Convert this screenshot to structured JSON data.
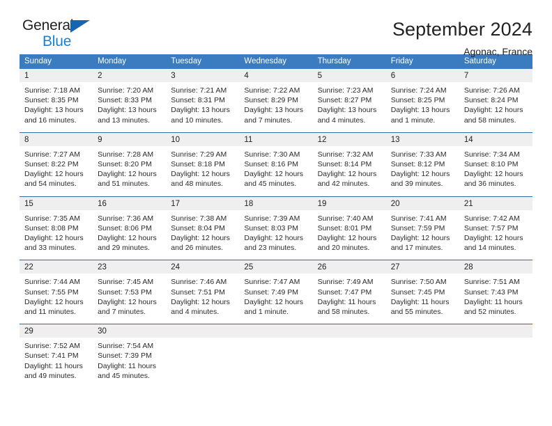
{
  "brand": {
    "name_top": "General",
    "name_bottom": "Blue",
    "triangle_color": "#1565b0",
    "text_color": "#231f20",
    "accent_color": "#1b7fd4"
  },
  "header": {
    "title": "September 2024",
    "subtitle": "Agonac, France"
  },
  "theme": {
    "header_bg": "#3b7cc0",
    "header_text": "#ffffff",
    "daynum_bg": "#efefef",
    "week_divider": "#2c68ac"
  },
  "calendar": {
    "weekday_headers": [
      "Sunday",
      "Monday",
      "Tuesday",
      "Wednesday",
      "Thursday",
      "Friday",
      "Saturday"
    ],
    "weeks": [
      [
        {
          "day": "1",
          "sunrise": "Sunrise: 7:18 AM",
          "sunset": "Sunset: 8:35 PM",
          "daylight_1": "Daylight: 13 hours",
          "daylight_2": "and 16 minutes."
        },
        {
          "day": "2",
          "sunrise": "Sunrise: 7:20 AM",
          "sunset": "Sunset: 8:33 PM",
          "daylight_1": "Daylight: 13 hours",
          "daylight_2": "and 13 minutes."
        },
        {
          "day": "3",
          "sunrise": "Sunrise: 7:21 AM",
          "sunset": "Sunset: 8:31 PM",
          "daylight_1": "Daylight: 13 hours",
          "daylight_2": "and 10 minutes."
        },
        {
          "day": "4",
          "sunrise": "Sunrise: 7:22 AM",
          "sunset": "Sunset: 8:29 PM",
          "daylight_1": "Daylight: 13 hours",
          "daylight_2": "and 7 minutes."
        },
        {
          "day": "5",
          "sunrise": "Sunrise: 7:23 AM",
          "sunset": "Sunset: 8:27 PM",
          "daylight_1": "Daylight: 13 hours",
          "daylight_2": "and 4 minutes."
        },
        {
          "day": "6",
          "sunrise": "Sunrise: 7:24 AM",
          "sunset": "Sunset: 8:25 PM",
          "daylight_1": "Daylight: 13 hours",
          "daylight_2": "and 1 minute."
        },
        {
          "day": "7",
          "sunrise": "Sunrise: 7:26 AM",
          "sunset": "Sunset: 8:24 PM",
          "daylight_1": "Daylight: 12 hours",
          "daylight_2": "and 58 minutes."
        }
      ],
      [
        {
          "day": "8",
          "sunrise": "Sunrise: 7:27 AM",
          "sunset": "Sunset: 8:22 PM",
          "daylight_1": "Daylight: 12 hours",
          "daylight_2": "and 54 minutes."
        },
        {
          "day": "9",
          "sunrise": "Sunrise: 7:28 AM",
          "sunset": "Sunset: 8:20 PM",
          "daylight_1": "Daylight: 12 hours",
          "daylight_2": "and 51 minutes."
        },
        {
          "day": "10",
          "sunrise": "Sunrise: 7:29 AM",
          "sunset": "Sunset: 8:18 PM",
          "daylight_1": "Daylight: 12 hours",
          "daylight_2": "and 48 minutes."
        },
        {
          "day": "11",
          "sunrise": "Sunrise: 7:30 AM",
          "sunset": "Sunset: 8:16 PM",
          "daylight_1": "Daylight: 12 hours",
          "daylight_2": "and 45 minutes."
        },
        {
          "day": "12",
          "sunrise": "Sunrise: 7:32 AM",
          "sunset": "Sunset: 8:14 PM",
          "daylight_1": "Daylight: 12 hours",
          "daylight_2": "and 42 minutes."
        },
        {
          "day": "13",
          "sunrise": "Sunrise: 7:33 AM",
          "sunset": "Sunset: 8:12 PM",
          "daylight_1": "Daylight: 12 hours",
          "daylight_2": "and 39 minutes."
        },
        {
          "day": "14",
          "sunrise": "Sunrise: 7:34 AM",
          "sunset": "Sunset: 8:10 PM",
          "daylight_1": "Daylight: 12 hours",
          "daylight_2": "and 36 minutes."
        }
      ],
      [
        {
          "day": "15",
          "sunrise": "Sunrise: 7:35 AM",
          "sunset": "Sunset: 8:08 PM",
          "daylight_1": "Daylight: 12 hours",
          "daylight_2": "and 33 minutes."
        },
        {
          "day": "16",
          "sunrise": "Sunrise: 7:36 AM",
          "sunset": "Sunset: 8:06 PM",
          "daylight_1": "Daylight: 12 hours",
          "daylight_2": "and 29 minutes."
        },
        {
          "day": "17",
          "sunrise": "Sunrise: 7:38 AM",
          "sunset": "Sunset: 8:04 PM",
          "daylight_1": "Daylight: 12 hours",
          "daylight_2": "and 26 minutes."
        },
        {
          "day": "18",
          "sunrise": "Sunrise: 7:39 AM",
          "sunset": "Sunset: 8:03 PM",
          "daylight_1": "Daylight: 12 hours",
          "daylight_2": "and 23 minutes."
        },
        {
          "day": "19",
          "sunrise": "Sunrise: 7:40 AM",
          "sunset": "Sunset: 8:01 PM",
          "daylight_1": "Daylight: 12 hours",
          "daylight_2": "and 20 minutes."
        },
        {
          "day": "20",
          "sunrise": "Sunrise: 7:41 AM",
          "sunset": "Sunset: 7:59 PM",
          "daylight_1": "Daylight: 12 hours",
          "daylight_2": "and 17 minutes."
        },
        {
          "day": "21",
          "sunrise": "Sunrise: 7:42 AM",
          "sunset": "Sunset: 7:57 PM",
          "daylight_1": "Daylight: 12 hours",
          "daylight_2": "and 14 minutes."
        }
      ],
      [
        {
          "day": "22",
          "sunrise": "Sunrise: 7:44 AM",
          "sunset": "Sunset: 7:55 PM",
          "daylight_1": "Daylight: 12 hours",
          "daylight_2": "and 11 minutes."
        },
        {
          "day": "23",
          "sunrise": "Sunrise: 7:45 AM",
          "sunset": "Sunset: 7:53 PM",
          "daylight_1": "Daylight: 12 hours",
          "daylight_2": "and 7 minutes."
        },
        {
          "day": "24",
          "sunrise": "Sunrise: 7:46 AM",
          "sunset": "Sunset: 7:51 PM",
          "daylight_1": "Daylight: 12 hours",
          "daylight_2": "and 4 minutes."
        },
        {
          "day": "25",
          "sunrise": "Sunrise: 7:47 AM",
          "sunset": "Sunset: 7:49 PM",
          "daylight_1": "Daylight: 12 hours",
          "daylight_2": "and 1 minute."
        },
        {
          "day": "26",
          "sunrise": "Sunrise: 7:49 AM",
          "sunset": "Sunset: 7:47 PM",
          "daylight_1": "Daylight: 11 hours",
          "daylight_2": "and 58 minutes."
        },
        {
          "day": "27",
          "sunrise": "Sunrise: 7:50 AM",
          "sunset": "Sunset: 7:45 PM",
          "daylight_1": "Daylight: 11 hours",
          "daylight_2": "and 55 minutes."
        },
        {
          "day": "28",
          "sunrise": "Sunrise: 7:51 AM",
          "sunset": "Sunset: 7:43 PM",
          "daylight_1": "Daylight: 11 hours",
          "daylight_2": "and 52 minutes."
        }
      ],
      [
        {
          "day": "29",
          "sunrise": "Sunrise: 7:52 AM",
          "sunset": "Sunset: 7:41 PM",
          "daylight_1": "Daylight: 11 hours",
          "daylight_2": "and 49 minutes."
        },
        {
          "day": "30",
          "sunrise": "Sunrise: 7:54 AM",
          "sunset": "Sunset: 7:39 PM",
          "daylight_1": "Daylight: 11 hours",
          "daylight_2": "and 45 minutes."
        },
        {
          "day": "",
          "sunrise": "",
          "sunset": "",
          "daylight_1": "",
          "daylight_2": ""
        },
        {
          "day": "",
          "sunrise": "",
          "sunset": "",
          "daylight_1": "",
          "daylight_2": ""
        },
        {
          "day": "",
          "sunrise": "",
          "sunset": "",
          "daylight_1": "",
          "daylight_2": ""
        },
        {
          "day": "",
          "sunrise": "",
          "sunset": "",
          "daylight_1": "",
          "daylight_2": ""
        },
        {
          "day": "",
          "sunrise": "",
          "sunset": "",
          "daylight_1": "",
          "daylight_2": ""
        }
      ]
    ]
  }
}
